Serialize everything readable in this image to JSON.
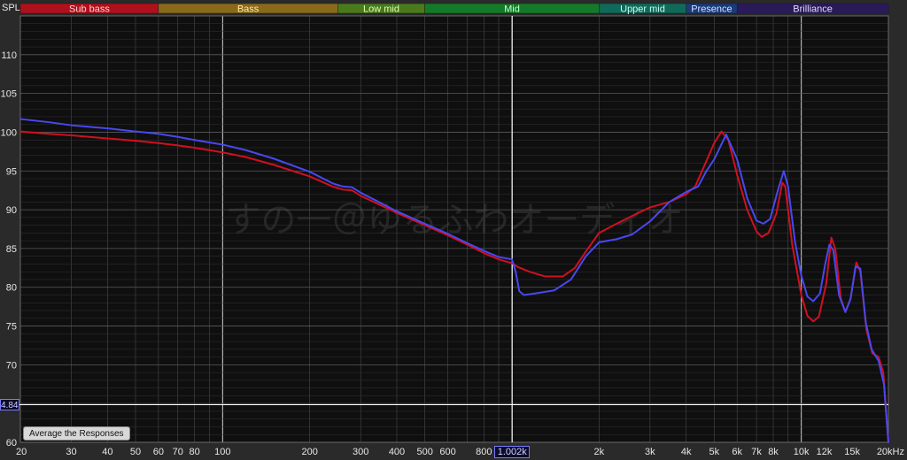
{
  "chart_data": {
    "type": "line",
    "ylabel": "SPL",
    "xscale": "log",
    "xlim": [
      20,
      20000
    ],
    "ylim": [
      60,
      115
    ],
    "grid": true,
    "yticks": [
      60,
      65,
      70,
      75,
      80,
      85,
      90,
      95,
      100,
      105,
      110
    ],
    "xticks": [
      {
        "value": 20,
        "label": "20"
      },
      {
        "value": 30,
        "label": "30"
      },
      {
        "value": 40,
        "label": "40"
      },
      {
        "value": 50,
        "label": "50"
      },
      {
        "value": 60,
        "label": "60"
      },
      {
        "value": 70,
        "label": "70"
      },
      {
        "value": 80,
        "label": "80"
      },
      {
        "value": 100,
        "label": "100"
      },
      {
        "value": 200,
        "label": "200"
      },
      {
        "value": 300,
        "label": "300"
      },
      {
        "value": 400,
        "label": "400"
      },
      {
        "value": 500,
        "label": "500"
      },
      {
        "value": 600,
        "label": "600"
      },
      {
        "value": 800,
        "label": "800"
      },
      {
        "value": 2000,
        "label": "2k"
      },
      {
        "value": 3000,
        "label": "3k"
      },
      {
        "value": 4000,
        "label": "4k"
      },
      {
        "value": 5000,
        "label": "5k"
      },
      {
        "value": 6000,
        "label": "6k"
      },
      {
        "value": 7000,
        "label": "7k"
      },
      {
        "value": 8000,
        "label": "8k"
      },
      {
        "value": 10000,
        "label": "10k"
      },
      {
        "value": 12000,
        "label": "12k"
      },
      {
        "value": 15000,
        "label": "15k"
      },
      {
        "value": 20000,
        "label": "20kHz"
      }
    ],
    "bands": [
      {
        "name": "Sub bass",
        "from": 20,
        "to": 60,
        "color": "#b0101c",
        "text_color": "#ffd0d0"
      },
      {
        "name": "Bass",
        "from": 60,
        "to": 250,
        "color": "#8a6a1a",
        "text_color": "#ffe6a0"
      },
      {
        "name": "Low mid",
        "from": 250,
        "to": 500,
        "color": "#4a7a1c",
        "text_color": "#d8ffb0"
      },
      {
        "name": "Mid",
        "from": 500,
        "to": 2000,
        "color": "#147a2a",
        "text_color": "#c8ffd0"
      },
      {
        "name": "Upper mid",
        "from": 2000,
        "to": 4000,
        "color": "#106a5a",
        "text_color": "#c0fff0"
      },
      {
        "name": "Presence",
        "from": 4000,
        "to": 6000,
        "color": "#1a3a7a",
        "text_color": "#d0e0ff"
      },
      {
        "name": "Brilliance",
        "from": 6000,
        "to": 20000,
        "color": "#2a1a5a",
        "text_color": "#e0d8ff"
      }
    ],
    "watermark": "すの一＠ゆるふわオーディオ",
    "cursor": {
      "x": 1002,
      "x_label": "1.002k",
      "y_label": "4.84"
    },
    "series": [
      {
        "color": "#d01020",
        "points": [
          [
            20,
            100.1
          ],
          [
            25,
            99.8
          ],
          [
            30,
            99.6
          ],
          [
            40,
            99.2
          ],
          [
            50,
            98.9
          ],
          [
            60,
            98.6
          ],
          [
            70,
            98.3
          ],
          [
            80,
            98.0
          ],
          [
            100,
            97.4
          ],
          [
            120,
            96.8
          ],
          [
            150,
            95.8
          ],
          [
            200,
            94.3
          ],
          [
            240,
            93.0
          ],
          [
            260,
            92.6
          ],
          [
            280,
            92.5
          ],
          [
            300,
            91.8
          ],
          [
            400,
            89.6
          ],
          [
            500,
            88.0
          ],
          [
            600,
            86.7
          ],
          [
            700,
            85.5
          ],
          [
            800,
            84.4
          ],
          [
            900,
            83.6
          ],
          [
            1000,
            83.1
          ],
          [
            1050,
            82.6
          ],
          [
            1150,
            82.0
          ],
          [
            1300,
            81.4
          ],
          [
            1500,
            81.4
          ],
          [
            1650,
            82.5
          ],
          [
            1800,
            84.6
          ],
          [
            2000,
            87.0
          ],
          [
            2300,
            88.2
          ],
          [
            2600,
            89.2
          ],
          [
            3000,
            90.3
          ],
          [
            3500,
            91.0
          ],
          [
            4000,
            92.0
          ],
          [
            4300,
            93.0
          ],
          [
            4600,
            95.5
          ],
          [
            5000,
            98.6
          ],
          [
            5300,
            100.1
          ],
          [
            5600,
            99.0
          ],
          [
            6000,
            94.5
          ],
          [
            6500,
            90.0
          ],
          [
            7000,
            87.2
          ],
          [
            7300,
            86.5
          ],
          [
            7700,
            87.0
          ],
          [
            8200,
            89.5
          ],
          [
            8600,
            93.5
          ],
          [
            8800,
            93.0
          ],
          [
            9300,
            85.5
          ],
          [
            10000,
            79.0
          ],
          [
            10500,
            76.3
          ],
          [
            11000,
            75.6
          ],
          [
            11500,
            76.2
          ],
          [
            12200,
            80.5
          ],
          [
            12700,
            86.4
          ],
          [
            13100,
            85.0
          ],
          [
            13700,
            78.5
          ],
          [
            14200,
            76.8
          ],
          [
            14800,
            78.5
          ],
          [
            15500,
            83.2
          ],
          [
            16000,
            82.0
          ],
          [
            16800,
            74.5
          ],
          [
            17600,
            71.5
          ],
          [
            18500,
            71.0
          ],
          [
            19200,
            69.0
          ],
          [
            20000,
            60.0
          ]
        ]
      },
      {
        "color": "#4848f0",
        "points": [
          [
            20,
            101.7
          ],
          [
            25,
            101.3
          ],
          [
            30,
            100.9
          ],
          [
            40,
            100.5
          ],
          [
            50,
            100.1
          ],
          [
            60,
            99.8
          ],
          [
            70,
            99.4
          ],
          [
            80,
            99.0
          ],
          [
            100,
            98.4
          ],
          [
            120,
            97.7
          ],
          [
            150,
            96.6
          ],
          [
            200,
            94.9
          ],
          [
            240,
            93.4
          ],
          [
            260,
            93.0
          ],
          [
            280,
            92.9
          ],
          [
            300,
            92.2
          ],
          [
            400,
            89.8
          ],
          [
            500,
            88.2
          ],
          [
            600,
            86.9
          ],
          [
            700,
            85.7
          ],
          [
            800,
            84.7
          ],
          [
            900,
            83.9
          ],
          [
            1000,
            83.6
          ],
          [
            1030,
            82.0
          ],
          [
            1060,
            79.5
          ],
          [
            1100,
            79.0
          ],
          [
            1200,
            79.2
          ],
          [
            1400,
            79.6
          ],
          [
            1600,
            81.0
          ],
          [
            1800,
            84.0
          ],
          [
            2000,
            85.8
          ],
          [
            2300,
            86.2
          ],
          [
            2600,
            86.8
          ],
          [
            3000,
            88.5
          ],
          [
            3500,
            91.0
          ],
          [
            4000,
            92.3
          ],
          [
            4400,
            93.0
          ],
          [
            4700,
            95.0
          ],
          [
            5000,
            96.5
          ],
          [
            5500,
            99.7
          ],
          [
            6000,
            96.5
          ],
          [
            6500,
            91.5
          ],
          [
            7000,
            88.6
          ],
          [
            7400,
            88.2
          ],
          [
            7800,
            88.8
          ],
          [
            8300,
            92.5
          ],
          [
            8700,
            95.0
          ],
          [
            9000,
            93.0
          ],
          [
            9500,
            86.0
          ],
          [
            10000,
            81.5
          ],
          [
            10500,
            78.8
          ],
          [
            11000,
            78.2
          ],
          [
            11600,
            79.2
          ],
          [
            12100,
            83.0
          ],
          [
            12500,
            85.5
          ],
          [
            12900,
            84.8
          ],
          [
            13500,
            79.0
          ],
          [
            14200,
            76.8
          ],
          [
            14800,
            78.5
          ],
          [
            15400,
            82.7
          ],
          [
            16000,
            82.4
          ],
          [
            16700,
            75.5
          ],
          [
            17500,
            72.0
          ],
          [
            18500,
            70.5
          ],
          [
            19300,
            67.5
          ],
          [
            20000,
            60.0
          ]
        ]
      }
    ]
  },
  "ui": {
    "average_button_label": "Average the Responses"
  }
}
